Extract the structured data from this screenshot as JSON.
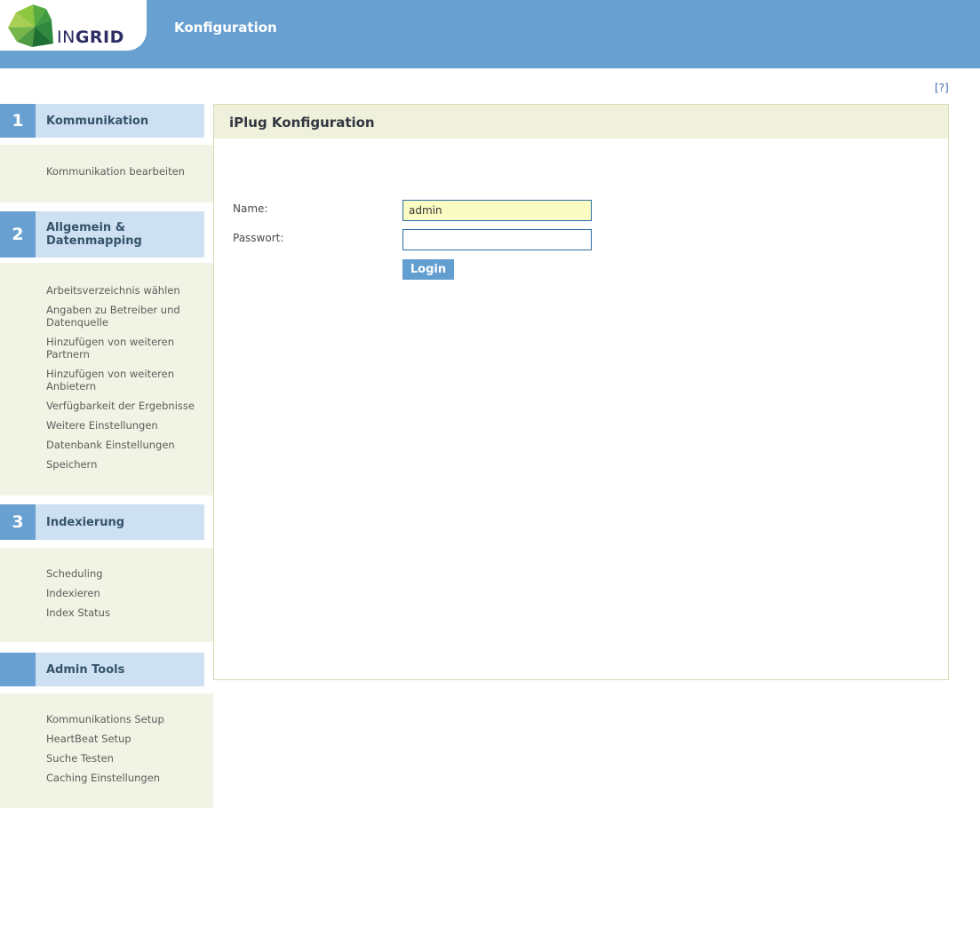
{
  "header": {
    "brand_in": "IN",
    "brand_grid": "GRID",
    "app_title": "Konfiguration",
    "help_label": "[?]"
  },
  "icons": {
    "logo": "ingrid-gem-icon"
  },
  "sidebar": {
    "sections": [
      {
        "number": "1",
        "label": "Kommunikation",
        "items": [
          "Kommunikation bearbeiten"
        ]
      },
      {
        "number": "2",
        "label": "Allgemein & Datenmapping",
        "items": [
          "Arbeitsverzeichnis wählen",
          "Angaben zu Betreiber und Datenquelle",
          "Hinzufügen von weiteren Partnern",
          "Hinzufügen von weiteren Anbietern",
          "Verfügbarkeit der Ergebnisse",
          "Weitere Einstellungen",
          "Datenbank Einstellungen",
          "Speichern"
        ]
      },
      {
        "number": "3",
        "label": "Indexierung",
        "items": [
          "Scheduling",
          "Indexieren",
          "Index Status"
        ]
      },
      {
        "number": "",
        "label": "Admin Tools",
        "items": [
          "Kommunikations Setup",
          "HeartBeat Setup",
          "Suche Testen",
          "Caching Einstellungen"
        ]
      }
    ]
  },
  "main": {
    "title": "iPlug Konfiguration",
    "form": {
      "name_label": "Name:",
      "name_value": "admin",
      "password_label": "Passwort:",
      "password_value": "",
      "login_label": "Login"
    }
  },
  "colors": {
    "header_blue": "#68a1d1",
    "section_header_bg": "#cde1f2",
    "section_text": "#36536a",
    "panel_bg": "#f1f3e4",
    "content_header_bg": "#eff1dc",
    "content_border": "#d9dbb3",
    "input_border": "#2e6da4",
    "name_input_bg": "#fbfcc3",
    "login_bg": "#639ed1",
    "brand_navy": "#2b2d64",
    "link_gray": "#5d5d5d",
    "help_link_blue": "#3f6fa8"
  }
}
